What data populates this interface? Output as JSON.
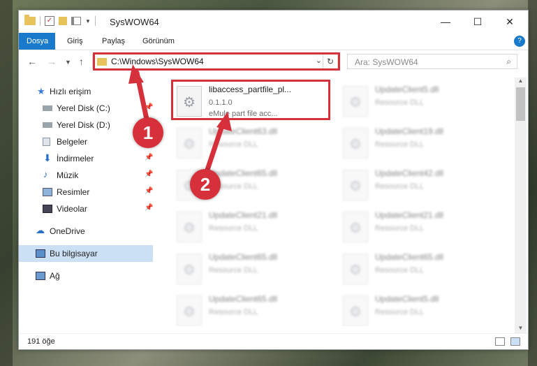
{
  "window": {
    "title": "SysWOW64"
  },
  "ribbon": {
    "tabs": [
      "Dosya",
      "Giriş",
      "Paylaş",
      "Görünüm"
    ]
  },
  "address": {
    "path": "C:\\Windows\\SysWOW64"
  },
  "search": {
    "placeholder": "Ara: SysWOW64"
  },
  "sidebar": {
    "items": [
      {
        "label": "Hızlı erişim",
        "icon": "star-icon"
      },
      {
        "label": "Yerel Disk (C:)",
        "icon": "drive-icon"
      },
      {
        "label": "Yerel Disk (D:)",
        "icon": "drive-icon"
      },
      {
        "label": "Belgeler",
        "icon": "documents-icon"
      },
      {
        "label": "İndirmeler",
        "icon": "download-icon"
      },
      {
        "label": "Müzik",
        "icon": "music-icon"
      },
      {
        "label": "Resimler",
        "icon": "pictures-icon"
      },
      {
        "label": "Videolar",
        "icon": "videos-icon"
      },
      {
        "label": "OneDrive",
        "icon": "cloud-icon"
      },
      {
        "label": "Bu bilgisayar",
        "icon": "computer-icon"
      },
      {
        "label": "Ağ",
        "icon": "network-icon"
      }
    ]
  },
  "files": [
    {
      "name": "libaccess_partfile_pl...",
      "version": "0.1.1.0",
      "description": "eMule part file acc..."
    },
    {
      "name": "UpdateClient5.dll",
      "description": "Resource DLL"
    },
    {
      "name": "UpdateClient63.dll",
      "description": "Resource DLL"
    },
    {
      "name": "UpdateClient19.dll",
      "description": "Resource DLL"
    },
    {
      "name": "UpdateClient65.dll",
      "description": "Resource DLL"
    },
    {
      "name": "UpdateClient42.dll",
      "description": "Resource DLL"
    },
    {
      "name": "UpdateClient21.dll",
      "description": "Resource DLL"
    },
    {
      "name": "UpdateClient21.dll",
      "description": "Resource DLL"
    },
    {
      "name": "UpdateClient65.dll",
      "description": "Resource DLL"
    },
    {
      "name": "UpdateClient65.dll",
      "description": "Resource DLL"
    },
    {
      "name": "UpdateClient65.dll",
      "description": "Resource DLL"
    },
    {
      "name": "UpdateClient5.dll",
      "description": "Resource DLL"
    }
  ],
  "status": {
    "count": "191 öğe"
  },
  "markers": [
    "1",
    "2"
  ],
  "colors": {
    "accent": "#1979ca",
    "highlight": "#d6303a",
    "selected": "#cce0f5"
  }
}
